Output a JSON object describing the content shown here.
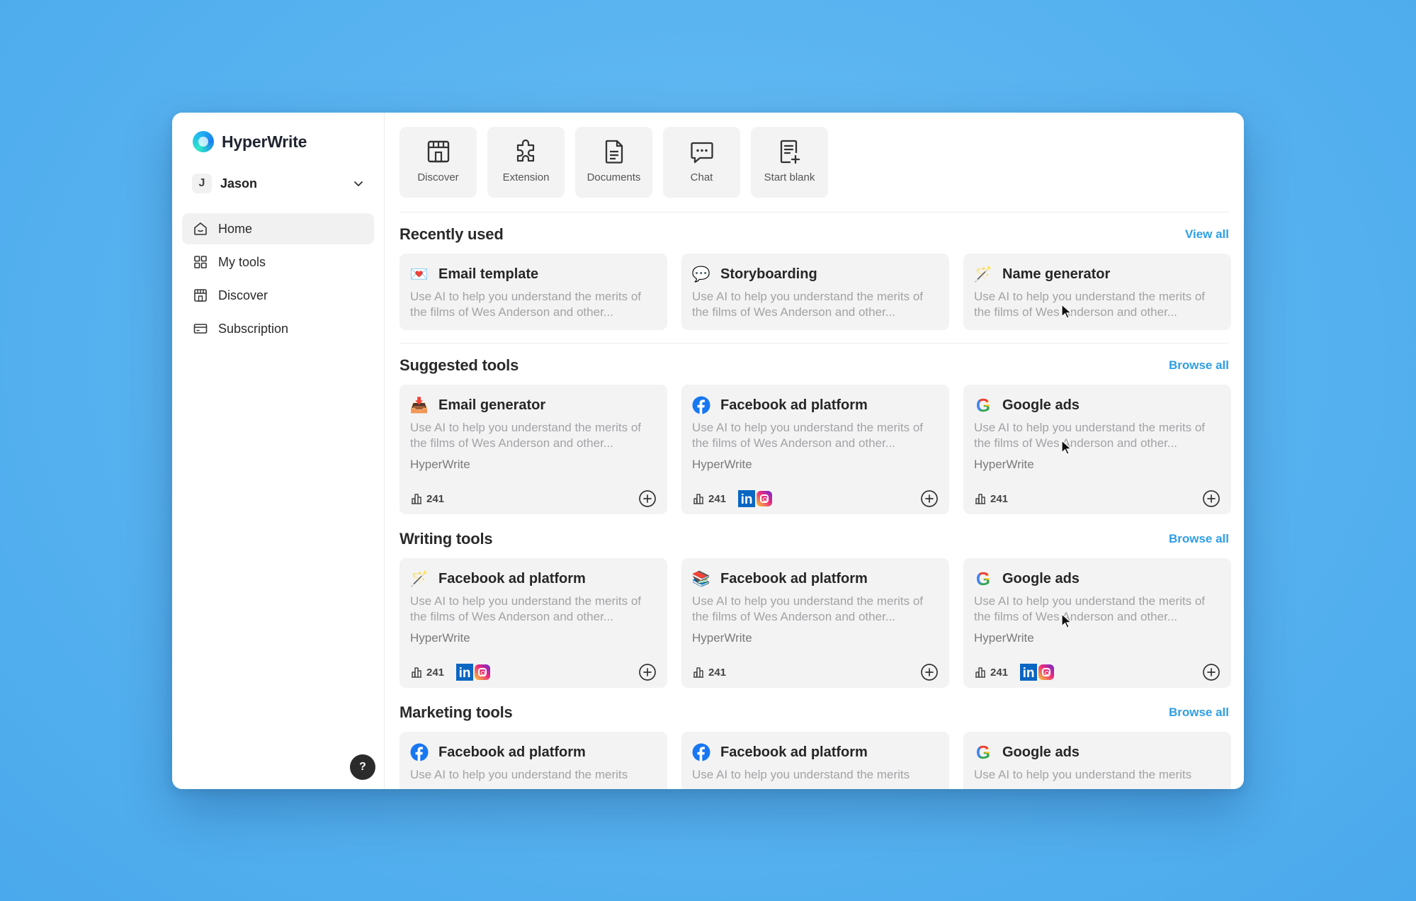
{
  "brand": {
    "name": "HyperWrite"
  },
  "user": {
    "initial": "J",
    "name": "Jason"
  },
  "nav": [
    {
      "label": "Home",
      "icon": "home-icon",
      "active": true
    },
    {
      "label": "My tools",
      "icon": "grid-icon"
    },
    {
      "label": "Discover",
      "icon": "store-icon"
    },
    {
      "label": "Subscription",
      "icon": "card-icon"
    }
  ],
  "help": {
    "label": "?"
  },
  "quick_actions": [
    {
      "label": "Discover",
      "icon": "store-icon"
    },
    {
      "label": "Extension",
      "icon": "puzzle-icon"
    },
    {
      "label": "Documents",
      "icon": "document-icon"
    },
    {
      "label": "Chat",
      "icon": "chat-icon"
    },
    {
      "label": "Start blank",
      "icon": "new-document-icon"
    }
  ],
  "recent": {
    "title": "Recently used",
    "link": "View all",
    "cards": [
      {
        "title": "Email template",
        "icon": "love-letter-emoji",
        "glyph": "💌",
        "desc": "Use AI to help you understand the merits of the films of Wes Anderson and other..."
      },
      {
        "title": "Storyboarding",
        "icon": "speech-bubble-emoji",
        "glyph": "💬",
        "desc": "Use AI to help you understand the merits of the films of Wes Anderson and other..."
      },
      {
        "title": "Name generator",
        "icon": "magic-wand-emoji",
        "glyph": "🪄",
        "desc": "Use AI to help you understand the merits of the films of Wes Anderson and other..."
      }
    ]
  },
  "suggested": {
    "title": "Suggested tools",
    "link": "Browse all",
    "cards": [
      {
        "title": "Email generator",
        "icon": "inbox-tray-emoji",
        "glyph": "📥",
        "desc": "Use AI to help you understand the merits of the films of Wes Anderson and other...",
        "author": "HyperWrite",
        "count": "241",
        "social": false
      },
      {
        "title": "Facebook ad platform",
        "icon": "facebook-icon",
        "desc": "Use AI to help you understand the merits of the films of Wes Anderson and other...",
        "author": "HyperWrite",
        "count": "241",
        "social": true
      },
      {
        "title": "Google ads",
        "icon": "google-icon",
        "desc": "Use AI to help you understand the merits of the films of Wes Anderson and other...",
        "author": "HyperWrite",
        "count": "241",
        "social": false
      }
    ]
  },
  "writing": {
    "title": "Writing tools",
    "link": "Browse all",
    "cards": [
      {
        "title": "Facebook ad platform",
        "icon": "magic-wand-emoji",
        "glyph": "🪄",
        "desc": "Use AI to help you understand the merits of the films of Wes Anderson and other...",
        "author": "HyperWrite",
        "count": "241",
        "social": true
      },
      {
        "title": "Facebook ad platform",
        "icon": "books-emoji",
        "glyph": "📚",
        "desc": "Use AI to help you understand the merits of the films of Wes Anderson and other...",
        "author": "HyperWrite",
        "count": "241",
        "social": false
      },
      {
        "title": "Google ads",
        "icon": "google-icon",
        "desc": "Use AI to help you understand the merits of the films of Wes Anderson and other...",
        "author": "HyperWrite",
        "count": "241",
        "social": true
      }
    ]
  },
  "marketing": {
    "title": "Marketing tools",
    "link": "Browse all",
    "cards": [
      {
        "title": "Facebook ad platform",
        "icon": "facebook-icon",
        "desc": "Use AI to help you understand the merits"
      },
      {
        "title": "Facebook ad platform",
        "icon": "facebook-icon",
        "desc": "Use AI to help you understand the merits"
      },
      {
        "title": "Google ads",
        "icon": "google-icon",
        "desc": "Use AI to help you understand the merits"
      }
    ]
  },
  "colors": {
    "accent": "#2f9ee6",
    "background": "#5ab4f0",
    "card": "#f3f3f4",
    "facebook": "#1877f2",
    "linkedin": "#0a66c2"
  }
}
